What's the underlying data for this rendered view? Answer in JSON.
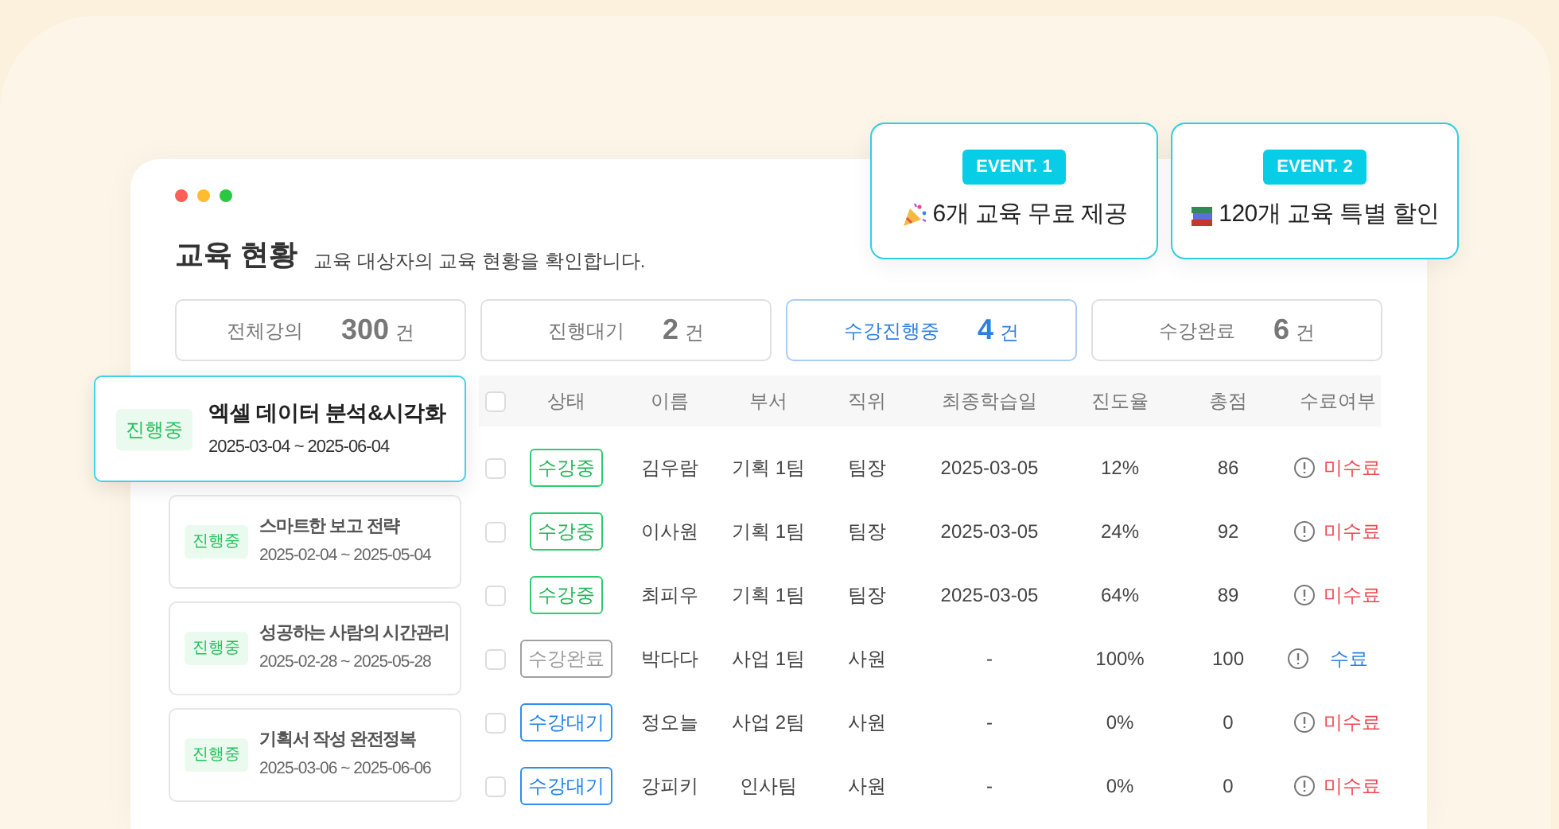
{
  "window": {
    "title": "교육 현황",
    "subtitle": "교육 대상자의 교육 현황을 확인합니다."
  },
  "events": [
    {
      "badge": "EVENT. 1",
      "text": "6개 교육 무료 제공",
      "kind": "party"
    },
    {
      "badge": "EVENT. 2",
      "text": "120개 교육 특별 할인",
      "kind": "books"
    }
  ],
  "stats": [
    {
      "label": "전체강의",
      "value": "300",
      "unit": "건",
      "selected": false
    },
    {
      "label": "진행대기",
      "value": "2",
      "unit": "건",
      "selected": false
    },
    {
      "label": "수강진행중",
      "value": "4",
      "unit": "건",
      "selected": true
    },
    {
      "label": "수강완료",
      "value": "6",
      "unit": "건",
      "selected": false
    }
  ],
  "courses": [
    {
      "badge": "진행중",
      "title": "엑셀 데이터 분석&시각화",
      "period": "2025-03-04 ~ 2025-06-04",
      "selected": true
    },
    {
      "badge": "진행중",
      "title": "스마트한 보고 전략",
      "period": "2025-02-04 ~ 2025-05-04",
      "selected": false
    },
    {
      "badge": "진행중",
      "title": "성공하는 사람의 시간관리",
      "period": "2025-02-28 ~ 2025-05-28",
      "selected": false
    },
    {
      "badge": "진행중",
      "title": "기획서 작성 완전정복",
      "period": "2025-03-06 ~ 2025-06-06",
      "selected": false
    }
  ],
  "table": {
    "header_checked": false,
    "columns": [
      "상태",
      "이름",
      "부서",
      "직위",
      "최종학습일",
      "진도율",
      "총점",
      "수료여부"
    ],
    "rows": [
      {
        "checked": false,
        "status": {
          "label": "수강중",
          "kind": "ongoing"
        },
        "name": "김우람",
        "dept": "기획 1팀",
        "position": "팀장",
        "last_date": "2025-03-05",
        "progress": "12%",
        "score": "86",
        "completion": {
          "label": "미수료",
          "kind": "incomplete"
        }
      },
      {
        "checked": false,
        "status": {
          "label": "수강중",
          "kind": "ongoing"
        },
        "name": "이사원",
        "dept": "기획 1팀",
        "position": "팀장",
        "last_date": "2025-03-05",
        "progress": "24%",
        "score": "92",
        "completion": {
          "label": "미수료",
          "kind": "incomplete"
        }
      },
      {
        "checked": false,
        "status": {
          "label": "수강중",
          "kind": "ongoing"
        },
        "name": "최피우",
        "dept": "기획 1팀",
        "position": "팀장",
        "last_date": "2025-03-05",
        "progress": "64%",
        "score": "89",
        "completion": {
          "label": "미수료",
          "kind": "incomplete"
        }
      },
      {
        "checked": false,
        "status": {
          "label": "수강완료",
          "kind": "done"
        },
        "name": "박다다",
        "dept": "사업 1팀",
        "position": "사원",
        "last_date": "-",
        "progress": "100%",
        "score": "100",
        "completion": {
          "label": "수료",
          "kind": "complete"
        }
      },
      {
        "checked": false,
        "status": {
          "label": "수강대기",
          "kind": "waiting"
        },
        "name": "정오늘",
        "dept": "사업 2팀",
        "position": "사원",
        "last_date": "-",
        "progress": "0%",
        "score": "0",
        "completion": {
          "label": "미수료",
          "kind": "incomplete"
        }
      },
      {
        "checked": false,
        "status": {
          "label": "수강대기",
          "kind": "waiting"
        },
        "name": "강피키",
        "dept": "인사팀",
        "position": "사원",
        "last_date": "-",
        "progress": "0%",
        "score": "0",
        "completion": {
          "label": "미수료",
          "kind": "incomplete"
        }
      }
    ]
  }
}
